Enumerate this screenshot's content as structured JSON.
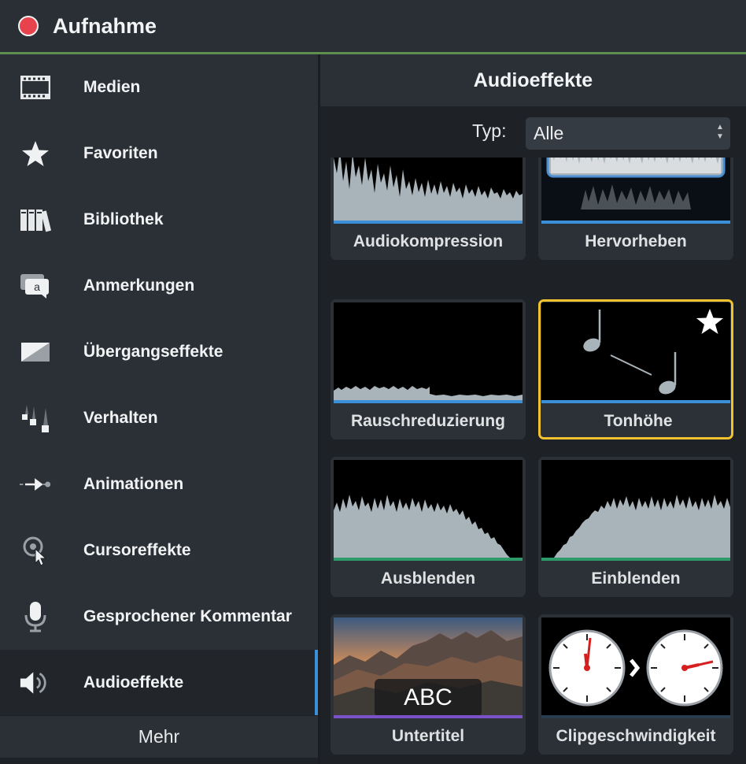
{
  "window": {
    "title": "Aufnahme",
    "record_color": "#e8434d",
    "accent_line_color": "#5f8f4e"
  },
  "sidebar": {
    "items": [
      {
        "label": "Medien",
        "icon": "film-icon"
      },
      {
        "label": "Favoriten",
        "icon": "star-icon"
      },
      {
        "label": "Bibliothek",
        "icon": "library-icon"
      },
      {
        "label": "Anmerkungen",
        "icon": "annotation-icon"
      },
      {
        "label": "Übergangseffekte",
        "icon": "transition-icon"
      },
      {
        "label": "Verhalten",
        "icon": "behavior-icon"
      },
      {
        "label": "Animationen",
        "icon": "animation-icon"
      },
      {
        "label": "Cursoreffekte",
        "icon": "cursor-icon"
      },
      {
        "label": "Gesprochener Kommentar",
        "icon": "microphone-icon"
      },
      {
        "label": "Audioeffekte",
        "icon": "speaker-icon",
        "active": true
      }
    ],
    "more_label": "Mehr"
  },
  "panel": {
    "title": "Audioeffekte",
    "filter": {
      "label": "Typ:",
      "value": "Alle"
    },
    "tiles": [
      {
        "label": "Audiokompression",
        "bar_color": "#3a8fd8"
      },
      {
        "label": "Hervorheben",
        "bar_color": "#3a8fd8"
      },
      {
        "label": "Rauschreduzierung",
        "bar_color": "#3a8fd8"
      },
      {
        "label": "Tonhöhe",
        "bar_color": "#3a8fd8",
        "selected": true,
        "favorite": true
      },
      {
        "label": "Ausblenden",
        "bar_color": "#2e9a6a"
      },
      {
        "label": "Einblenden",
        "bar_color": "#2e9a6a"
      },
      {
        "label": "Untertitel",
        "bar_color": "#7a52c7",
        "caption": "ABC"
      },
      {
        "label": "Clipgeschwindigkeit",
        "bar_color": "#2a3b4e"
      }
    ]
  }
}
